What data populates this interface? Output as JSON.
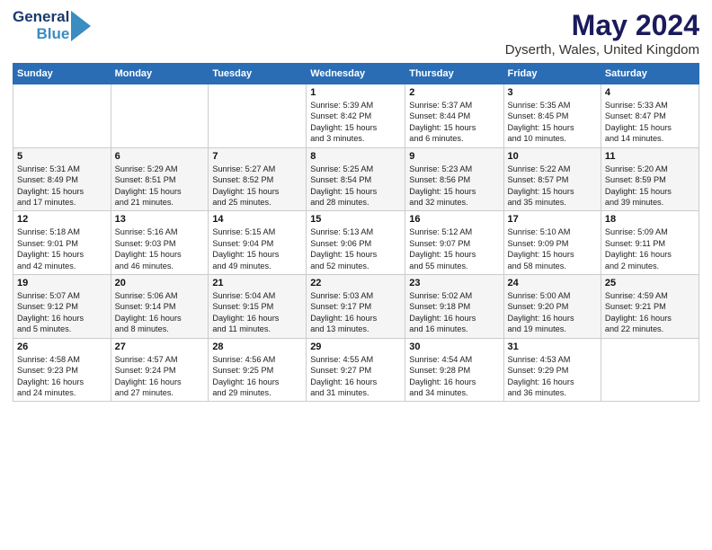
{
  "logo": {
    "line1": "General",
    "line2": "Blue"
  },
  "title": {
    "month_year": "May 2024",
    "location": "Dyserth, Wales, United Kingdom"
  },
  "days_of_week": [
    "Sunday",
    "Monday",
    "Tuesday",
    "Wednesday",
    "Thursday",
    "Friday",
    "Saturday"
  ],
  "weeks": [
    [
      {
        "day": "",
        "info": ""
      },
      {
        "day": "",
        "info": ""
      },
      {
        "day": "",
        "info": ""
      },
      {
        "day": "1",
        "info": "Sunrise: 5:39 AM\nSunset: 8:42 PM\nDaylight: 15 hours\nand 3 minutes."
      },
      {
        "day": "2",
        "info": "Sunrise: 5:37 AM\nSunset: 8:44 PM\nDaylight: 15 hours\nand 6 minutes."
      },
      {
        "day": "3",
        "info": "Sunrise: 5:35 AM\nSunset: 8:45 PM\nDaylight: 15 hours\nand 10 minutes."
      },
      {
        "day": "4",
        "info": "Sunrise: 5:33 AM\nSunset: 8:47 PM\nDaylight: 15 hours\nand 14 minutes."
      }
    ],
    [
      {
        "day": "5",
        "info": "Sunrise: 5:31 AM\nSunset: 8:49 PM\nDaylight: 15 hours\nand 17 minutes."
      },
      {
        "day": "6",
        "info": "Sunrise: 5:29 AM\nSunset: 8:51 PM\nDaylight: 15 hours\nand 21 minutes."
      },
      {
        "day": "7",
        "info": "Sunrise: 5:27 AM\nSunset: 8:52 PM\nDaylight: 15 hours\nand 25 minutes."
      },
      {
        "day": "8",
        "info": "Sunrise: 5:25 AM\nSunset: 8:54 PM\nDaylight: 15 hours\nand 28 minutes."
      },
      {
        "day": "9",
        "info": "Sunrise: 5:23 AM\nSunset: 8:56 PM\nDaylight: 15 hours\nand 32 minutes."
      },
      {
        "day": "10",
        "info": "Sunrise: 5:22 AM\nSunset: 8:57 PM\nDaylight: 15 hours\nand 35 minutes."
      },
      {
        "day": "11",
        "info": "Sunrise: 5:20 AM\nSunset: 8:59 PM\nDaylight: 15 hours\nand 39 minutes."
      }
    ],
    [
      {
        "day": "12",
        "info": "Sunrise: 5:18 AM\nSunset: 9:01 PM\nDaylight: 15 hours\nand 42 minutes."
      },
      {
        "day": "13",
        "info": "Sunrise: 5:16 AM\nSunset: 9:03 PM\nDaylight: 15 hours\nand 46 minutes."
      },
      {
        "day": "14",
        "info": "Sunrise: 5:15 AM\nSunset: 9:04 PM\nDaylight: 15 hours\nand 49 minutes."
      },
      {
        "day": "15",
        "info": "Sunrise: 5:13 AM\nSunset: 9:06 PM\nDaylight: 15 hours\nand 52 minutes."
      },
      {
        "day": "16",
        "info": "Sunrise: 5:12 AM\nSunset: 9:07 PM\nDaylight: 15 hours\nand 55 minutes."
      },
      {
        "day": "17",
        "info": "Sunrise: 5:10 AM\nSunset: 9:09 PM\nDaylight: 15 hours\nand 58 minutes."
      },
      {
        "day": "18",
        "info": "Sunrise: 5:09 AM\nSunset: 9:11 PM\nDaylight: 16 hours\nand 2 minutes."
      }
    ],
    [
      {
        "day": "19",
        "info": "Sunrise: 5:07 AM\nSunset: 9:12 PM\nDaylight: 16 hours\nand 5 minutes."
      },
      {
        "day": "20",
        "info": "Sunrise: 5:06 AM\nSunset: 9:14 PM\nDaylight: 16 hours\nand 8 minutes."
      },
      {
        "day": "21",
        "info": "Sunrise: 5:04 AM\nSunset: 9:15 PM\nDaylight: 16 hours\nand 11 minutes."
      },
      {
        "day": "22",
        "info": "Sunrise: 5:03 AM\nSunset: 9:17 PM\nDaylight: 16 hours\nand 13 minutes."
      },
      {
        "day": "23",
        "info": "Sunrise: 5:02 AM\nSunset: 9:18 PM\nDaylight: 16 hours\nand 16 minutes."
      },
      {
        "day": "24",
        "info": "Sunrise: 5:00 AM\nSunset: 9:20 PM\nDaylight: 16 hours\nand 19 minutes."
      },
      {
        "day": "25",
        "info": "Sunrise: 4:59 AM\nSunset: 9:21 PM\nDaylight: 16 hours\nand 22 minutes."
      }
    ],
    [
      {
        "day": "26",
        "info": "Sunrise: 4:58 AM\nSunset: 9:23 PM\nDaylight: 16 hours\nand 24 minutes."
      },
      {
        "day": "27",
        "info": "Sunrise: 4:57 AM\nSunset: 9:24 PM\nDaylight: 16 hours\nand 27 minutes."
      },
      {
        "day": "28",
        "info": "Sunrise: 4:56 AM\nSunset: 9:25 PM\nDaylight: 16 hours\nand 29 minutes."
      },
      {
        "day": "29",
        "info": "Sunrise: 4:55 AM\nSunset: 9:27 PM\nDaylight: 16 hours\nand 31 minutes."
      },
      {
        "day": "30",
        "info": "Sunrise: 4:54 AM\nSunset: 9:28 PM\nDaylight: 16 hours\nand 34 minutes."
      },
      {
        "day": "31",
        "info": "Sunrise: 4:53 AM\nSunset: 9:29 PM\nDaylight: 16 hours\nand 36 minutes."
      },
      {
        "day": "",
        "info": ""
      }
    ]
  ]
}
